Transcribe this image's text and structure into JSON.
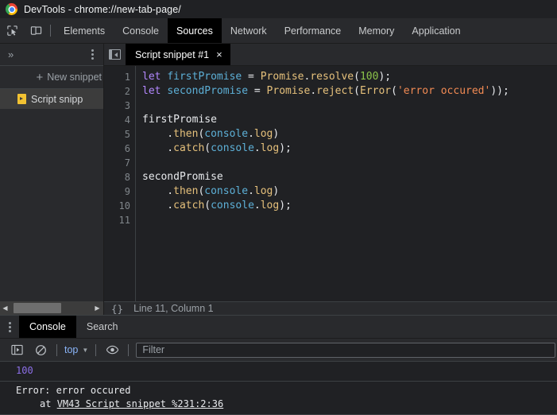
{
  "titlebar": {
    "title": "DevTools - chrome://new-tab-page/",
    "logo_icon": "chrome-logo"
  },
  "main_toolbar": {
    "inspect_icon": "inspect-element-icon",
    "device_icon": "device-toolbar-icon",
    "tabs": [
      {
        "label": "Elements",
        "active": false
      },
      {
        "label": "Console",
        "active": false
      },
      {
        "label": "Sources",
        "active": true
      },
      {
        "label": "Network",
        "active": false
      },
      {
        "label": "Performance",
        "active": false
      },
      {
        "label": "Memory",
        "active": false
      },
      {
        "label": "Application",
        "active": false
      }
    ]
  },
  "sidebar": {
    "collapse_icon": "double-chevron-right-icon",
    "more_icon": "kebab-menu-icon",
    "new_snippet_label": "New snippet",
    "new_snippet_plus": "+",
    "snippet_item": {
      "label": "Script snipp",
      "icon": "js-file-icon",
      "selected": true
    }
  },
  "editor": {
    "panel_toggle_icon": "show-navigator-icon",
    "tab": {
      "label": "Script snippet #1",
      "close_icon": "close-icon",
      "close_glyph": "×"
    },
    "line_numbers": [
      "1",
      "2",
      "3",
      "4",
      "5",
      "6",
      "7",
      "8",
      "9",
      "10",
      "11"
    ],
    "code_lines": [
      [
        {
          "t": "let ",
          "c": "k"
        },
        {
          "t": "firstPromise",
          "c": "var"
        },
        {
          "t": " = ",
          "c": "pl"
        },
        {
          "t": "Promise",
          "c": "fn"
        },
        {
          "t": ".",
          "c": "pl"
        },
        {
          "t": "resolve",
          "c": "fn"
        },
        {
          "t": "(",
          "c": "pl"
        },
        {
          "t": "100",
          "c": "num"
        },
        {
          "t": ");",
          "c": "pl"
        }
      ],
      [
        {
          "t": "let ",
          "c": "k"
        },
        {
          "t": "secondPromise",
          "c": "var"
        },
        {
          "t": " = ",
          "c": "pl"
        },
        {
          "t": "Promise",
          "c": "fn"
        },
        {
          "t": ".",
          "c": "pl"
        },
        {
          "t": "reject",
          "c": "fn"
        },
        {
          "t": "(",
          "c": "pl"
        },
        {
          "t": "Error",
          "c": "fn"
        },
        {
          "t": "(",
          "c": "pl"
        },
        {
          "t": "'error occured'",
          "c": "str"
        },
        {
          "t": "));",
          "c": "pl"
        }
      ],
      [],
      [
        {
          "t": "firstPromise",
          "c": "pl"
        }
      ],
      [
        {
          "t": "    .",
          "c": "pl"
        },
        {
          "t": "then",
          "c": "fn"
        },
        {
          "t": "(",
          "c": "pl"
        },
        {
          "t": "console",
          "c": "var"
        },
        {
          "t": ".",
          "c": "pl"
        },
        {
          "t": "log",
          "c": "fn"
        },
        {
          "t": ")",
          "c": "pl"
        }
      ],
      [
        {
          "t": "    .",
          "c": "pl"
        },
        {
          "t": "catch",
          "c": "fn"
        },
        {
          "t": "(",
          "c": "pl"
        },
        {
          "t": "console",
          "c": "var"
        },
        {
          "t": ".",
          "c": "pl"
        },
        {
          "t": "log",
          "c": "fn"
        },
        {
          "t": ");",
          "c": "pl"
        }
      ],
      [],
      [
        {
          "t": "secondPromise",
          "c": "pl"
        }
      ],
      [
        {
          "t": "    .",
          "c": "pl"
        },
        {
          "t": "then",
          "c": "fn"
        },
        {
          "t": "(",
          "c": "pl"
        },
        {
          "t": "console",
          "c": "var"
        },
        {
          "t": ".",
          "c": "pl"
        },
        {
          "t": "log",
          "c": "fn"
        },
        {
          "t": ")",
          "c": "pl"
        }
      ],
      [
        {
          "t": "    .",
          "c": "pl"
        },
        {
          "t": "catch",
          "c": "fn"
        },
        {
          "t": "(",
          "c": "pl"
        },
        {
          "t": "console",
          "c": "var"
        },
        {
          "t": ".",
          "c": "pl"
        },
        {
          "t": "log",
          "c": "fn"
        },
        {
          "t": ");",
          "c": "pl"
        }
      ],
      []
    ]
  },
  "status_bar": {
    "pretty_print_label": "{}",
    "pretty_print_icon": "pretty-print-icon",
    "cursor_position": "Line 11, Column 1",
    "scroll_left_glyph": "◀",
    "scroll_right_glyph": "▶"
  },
  "drawer": {
    "more_icon": "kebab-menu-icon",
    "tabs": [
      {
        "label": "Console",
        "active": true
      },
      {
        "label": "Search",
        "active": false
      }
    ],
    "toolbar": {
      "sidebar_icon": "console-sidebar-icon",
      "clear_icon": "clear-console-icon",
      "context_value": "top",
      "context_caret": "▼",
      "eye_icon": "live-expression-icon",
      "filter_placeholder": "Filter"
    },
    "messages": [
      {
        "kind": "result",
        "text": "100"
      },
      {
        "kind": "error",
        "text": "Error: error occured",
        "stack_prefix": "at ",
        "stack_link": "VM43 Script snippet %231:2:36"
      }
    ]
  }
}
